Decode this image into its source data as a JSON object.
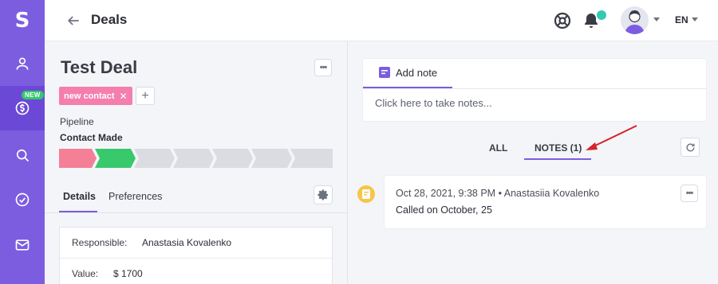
{
  "sidebar": {
    "logo": "S",
    "new_badge": "NEW",
    "items": [
      {
        "icon": "user-icon"
      },
      {
        "icon": "dollar-icon",
        "active": true
      },
      {
        "icon": "search-icon"
      },
      {
        "icon": "check-circle-icon"
      },
      {
        "icon": "mail-icon"
      }
    ]
  },
  "header": {
    "title": "Deals",
    "lang": "EN"
  },
  "deal": {
    "title": "Test Deal",
    "tag": "new contact",
    "pipeline_label": "Pipeline",
    "stage": "Contact Made",
    "pipeline_stages": [
      {
        "color": "#f47f96"
      },
      {
        "color": "#37c96b"
      },
      {
        "color": "#dadce2"
      },
      {
        "color": "#dadce2"
      },
      {
        "color": "#dadce2"
      },
      {
        "color": "#dadce2"
      },
      {
        "color": "#dadce2"
      }
    ],
    "tabs": [
      "Details",
      "Preferences"
    ],
    "fields": [
      {
        "label": "Responsible:",
        "value": "Anastasia Kovalenko"
      },
      {
        "label": "Value:",
        "value": "$ 1700"
      }
    ]
  },
  "notes": {
    "add_tab": "Add note",
    "placeholder": "Click here to take notes...",
    "filters": [
      "ALL",
      "NOTES (1)"
    ],
    "entry": {
      "date": "Oct 28, 2021, 9:38 PM",
      "author": "Anastasiia Kovalenko",
      "text": "Called on October, 25"
    }
  },
  "colors": {
    "accent": "#7c5de0",
    "tag": "#f47fae",
    "annotation_arrow": "#d8232a"
  }
}
